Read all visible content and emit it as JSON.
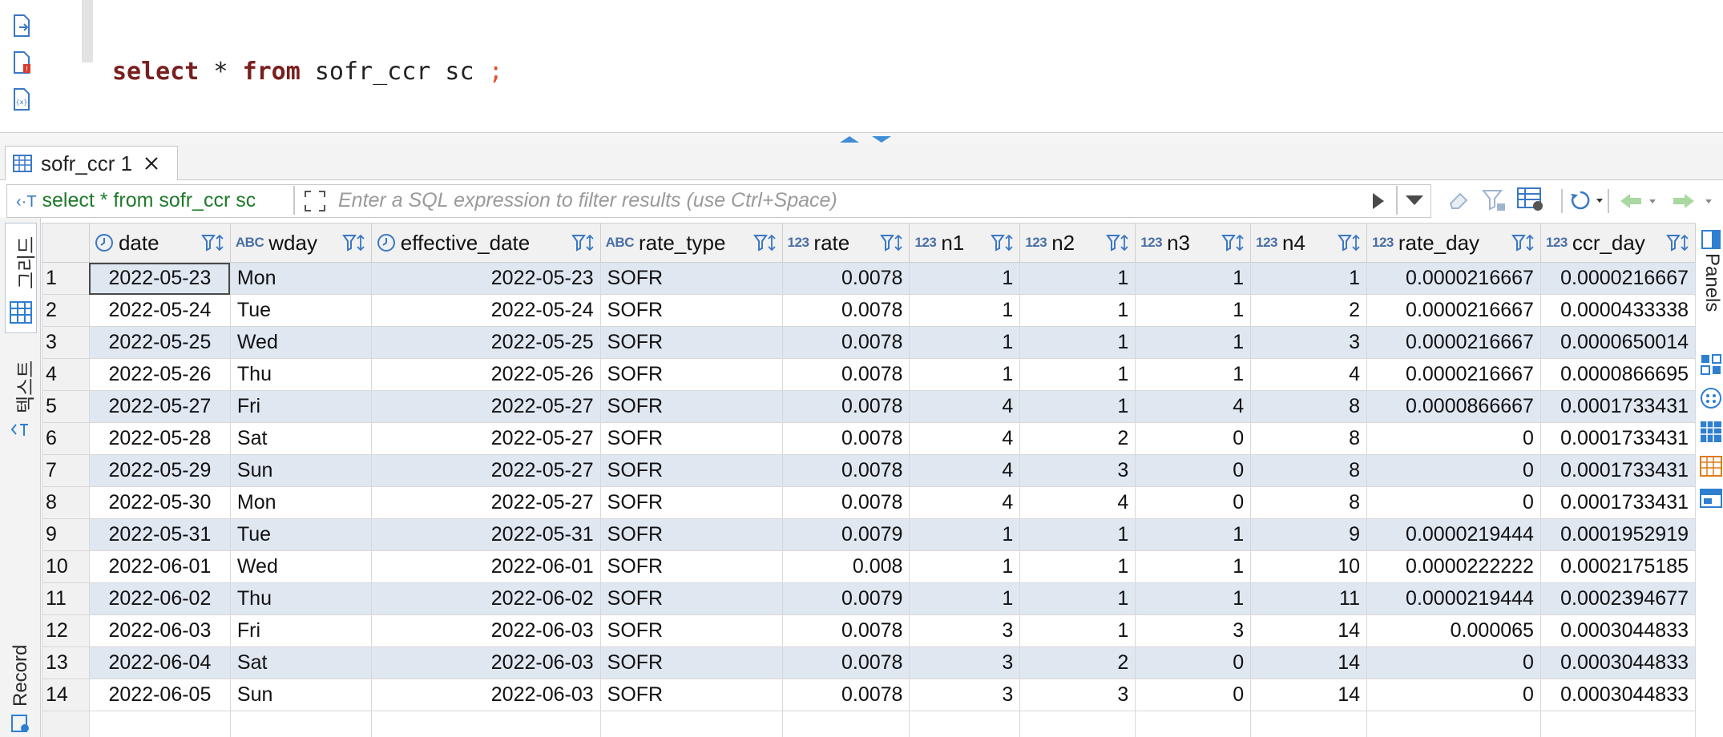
{
  "editor": {
    "sql": {
      "kw1": "select",
      "star": " * ",
      "kw2": "from",
      "rest": " sofr_ccr sc ",
      "semi": ";"
    }
  },
  "tab": {
    "label": "sofr_ccr 1"
  },
  "filter": {
    "query": "select * from sofr_ccr sc",
    "placeholder": "Enter a SQL expression to filter results (use Ctrl+Space)"
  },
  "left_panel": {
    "grid_label": "그리드",
    "text_label": "텍스트",
    "record_label": "Record"
  },
  "right_panel": {
    "panels_label": "Panels"
  },
  "grid": {
    "columns": [
      {
        "name": "date",
        "type_icon": "clock-icon"
      },
      {
        "name": "wday",
        "type_icon": "ABC"
      },
      {
        "name": "effective_date",
        "type_icon": "clock-icon"
      },
      {
        "name": "rate_type",
        "type_icon": "ABC"
      },
      {
        "name": "rate",
        "type_icon": "123"
      },
      {
        "name": "n1",
        "type_icon": "123"
      },
      {
        "name": "n2",
        "type_icon": "123"
      },
      {
        "name": "n3",
        "type_icon": "123"
      },
      {
        "name": "n4",
        "type_icon": "123"
      },
      {
        "name": "rate_day",
        "type_icon": "123"
      },
      {
        "name": "ccr_day",
        "type_icon": "123"
      }
    ],
    "rows": [
      [
        "1",
        "2022-05-23",
        "Mon",
        "2022-05-23",
        "SOFR",
        "0.0078",
        "1",
        "1",
        "1",
        "1",
        "0.0000216667",
        "0.0000216667"
      ],
      [
        "2",
        "2022-05-24",
        "Tue",
        "2022-05-24",
        "SOFR",
        "0.0078",
        "1",
        "1",
        "1",
        "2",
        "0.0000216667",
        "0.0000433338"
      ],
      [
        "3",
        "2022-05-25",
        "Wed",
        "2022-05-25",
        "SOFR",
        "0.0078",
        "1",
        "1",
        "1",
        "3",
        "0.0000216667",
        "0.0000650014"
      ],
      [
        "4",
        "2022-05-26",
        "Thu",
        "2022-05-26",
        "SOFR",
        "0.0078",
        "1",
        "1",
        "1",
        "4",
        "0.0000216667",
        "0.0000866695"
      ],
      [
        "5",
        "2022-05-27",
        "Fri",
        "2022-05-27",
        "SOFR",
        "0.0078",
        "4",
        "1",
        "4",
        "8",
        "0.0000866667",
        "0.0001733431"
      ],
      [
        "6",
        "2022-05-28",
        "Sat",
        "2022-05-27",
        "SOFR",
        "0.0078",
        "4",
        "2",
        "0",
        "8",
        "0",
        "0.0001733431"
      ],
      [
        "7",
        "2022-05-29",
        "Sun",
        "2022-05-27",
        "SOFR",
        "0.0078",
        "4",
        "3",
        "0",
        "8",
        "0",
        "0.0001733431"
      ],
      [
        "8",
        "2022-05-30",
        "Mon",
        "2022-05-27",
        "SOFR",
        "0.0078",
        "4",
        "4",
        "0",
        "8",
        "0",
        "0.0001733431"
      ],
      [
        "9",
        "2022-05-31",
        "Tue",
        "2022-05-31",
        "SOFR",
        "0.0079",
        "1",
        "1",
        "1",
        "9",
        "0.0000219444",
        "0.0001952919"
      ],
      [
        "10",
        "2022-06-01",
        "Wed",
        "2022-06-01",
        "SOFR",
        "0.008",
        "1",
        "1",
        "1",
        "10",
        "0.0000222222",
        "0.0002175185"
      ],
      [
        "11",
        "2022-06-02",
        "Thu",
        "2022-06-02",
        "SOFR",
        "0.0079",
        "1",
        "1",
        "1",
        "11",
        "0.0000219444",
        "0.0002394677"
      ],
      [
        "12",
        "2022-06-03",
        "Fri",
        "2022-06-03",
        "SOFR",
        "0.0078",
        "3",
        "1",
        "3",
        "14",
        "0.000065",
        "0.0003044833"
      ],
      [
        "13",
        "2022-06-04",
        "Sat",
        "2022-06-03",
        "SOFR",
        "0.0078",
        "3",
        "2",
        "0",
        "14",
        "0",
        "0.0003044833"
      ],
      [
        "14",
        "2022-06-05",
        "Sun",
        "2022-06-03",
        "SOFR",
        "0.0078",
        "3",
        "3",
        "0",
        "14",
        "0",
        "0.0003044833"
      ]
    ]
  },
  "colors": {
    "row_alt": "#dfe7f1",
    "keyword": "#7a1e1e",
    "filter_text": "#1f7a2b",
    "accent": "#2f7fd0"
  }
}
